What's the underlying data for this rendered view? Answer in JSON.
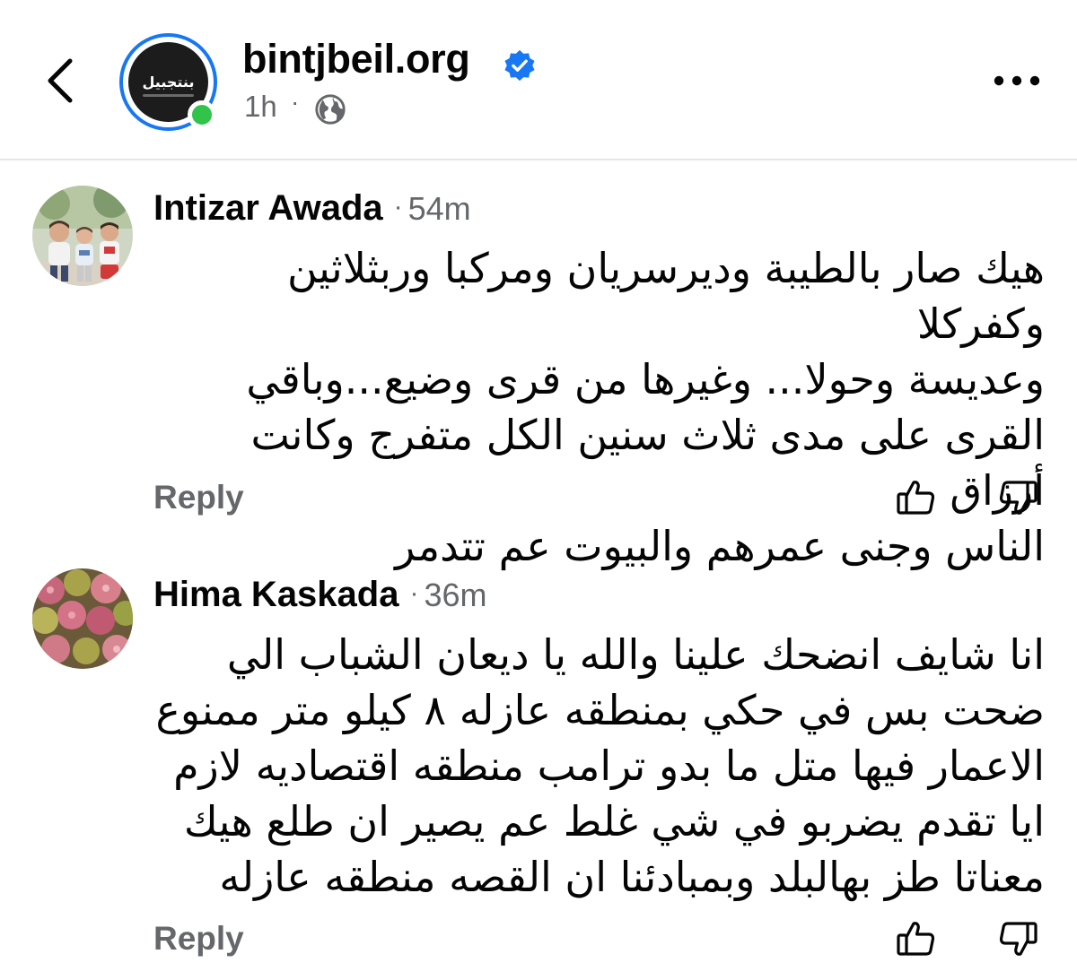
{
  "header": {
    "page_name": "bintjbeil.org",
    "time": "1h",
    "meta_separator": "·",
    "avatar_text": "بنتجبيل",
    "verified": true,
    "icons": {
      "back": "chevron-left-icon",
      "verified": "verified-badge-icon",
      "audience": "globe-icon",
      "more": "more-horizontal-icon"
    },
    "colors": {
      "accent": "#1877f2",
      "online": "#31c44a",
      "secondary_text": "#65676b"
    }
  },
  "comments": [
    {
      "author": "Intizar Awada",
      "separator": "·",
      "time": "54m",
      "lines": [
        "هيك صار بالطيبة وديرسريان ومركبا وربثلاثين وكفركلا",
        "وعديسة وحولا... وغيرها من قرى وضيع...وباقي",
        "القرى على مدى ثلاث سنين الكل متفرج وكانت أرزاق",
        "الناس وجنى عمرهم والبيوت عم تتدمر"
      ],
      "reply_label": "Reply",
      "like_icon": "thumbs-up-icon",
      "dislike_icon": "thumbs-down-icon"
    },
    {
      "author": "Hima Kaskada",
      "separator": "·",
      "time": "36m",
      "lines": [
        "انا شايف انضحك علينا والله يا ديعان الشباب الي",
        "ضحت بس في حكي بمنطقه عازله ٨ كيلو متر ممنوع",
        "الاعمار فيها متل ما بدو ترامب منطقه اقتصاديه لازم",
        "ايا تقدم يضربو في شي غلط عم يصير ان طلع هيك",
        "معناتا طز بهالبلد وبمبادئنا ان القصه منطقه عازله"
      ],
      "reply_label": "Reply",
      "like_icon": "thumbs-up-icon",
      "dislike_icon": "thumbs-down-icon"
    }
  ]
}
